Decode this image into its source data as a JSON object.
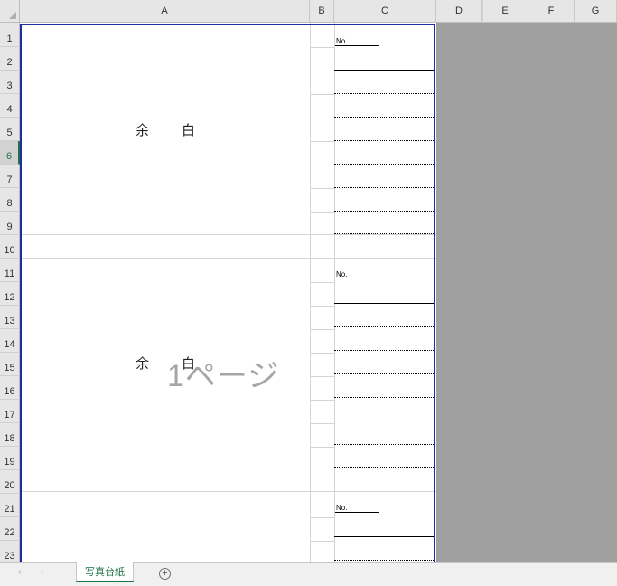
{
  "columns": [
    "A",
    "B",
    "C",
    "D",
    "E",
    "F",
    "G"
  ],
  "rows": [
    "1",
    "2",
    "3",
    "4",
    "5",
    "6",
    "7",
    "8",
    "9",
    "10",
    "11",
    "12",
    "13",
    "14",
    "15",
    "16",
    "17",
    "18",
    "19",
    "20",
    "21",
    "22",
    "23"
  ],
  "selected_row": "6",
  "blocks": [
    {
      "label_left": "余",
      "label_right": "白",
      "no_label": "No."
    },
    {
      "label_left": "余",
      "label_right": "白",
      "no_label": "No."
    },
    {
      "no_label": "No."
    }
  ],
  "watermark": "1ページ",
  "sheet_tab": "写真台紙",
  "add_sheet_symbol": "+",
  "nav_prev": "‹",
  "nav_next": "›",
  "colors": {
    "page_border": "#1f2d9e",
    "tab_accent": "#217346",
    "outside_print_area": "#a0a0a0"
  }
}
